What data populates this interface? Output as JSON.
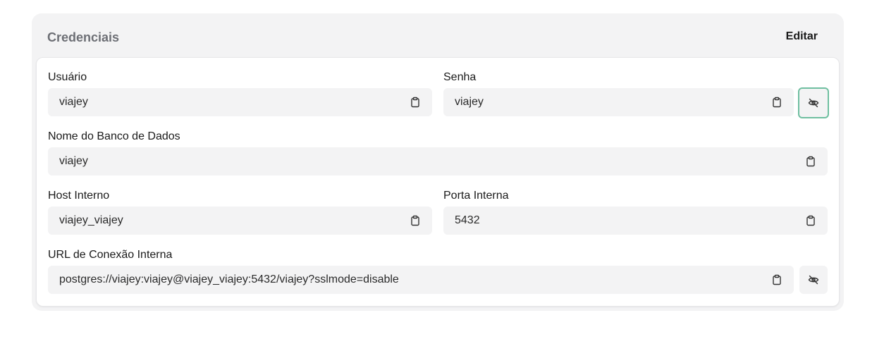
{
  "card": {
    "title": "Credenciais",
    "edit_label": "Editar"
  },
  "fields": {
    "user": {
      "label": "Usuário",
      "value": "viajey"
    },
    "password": {
      "label": "Senha",
      "value": "viajey"
    },
    "database": {
      "label": "Nome do Banco de Dados",
      "value": "viajey"
    },
    "host": {
      "label": "Host Interno",
      "value": "viajey_viajey"
    },
    "port": {
      "label": "Porta Interna",
      "value": "5432"
    },
    "url": {
      "label": "URL de Conexão Interna",
      "value": "postgres://viajey:viajey@viajey_viajey:5432/viajey?sslmode=disable"
    }
  },
  "icons": {
    "copy": "clipboard-icon",
    "toggle": "eye-off-icon"
  },
  "colors": {
    "focus_ring": "#6fbfa0",
    "field_bg": "#f3f3f4"
  }
}
